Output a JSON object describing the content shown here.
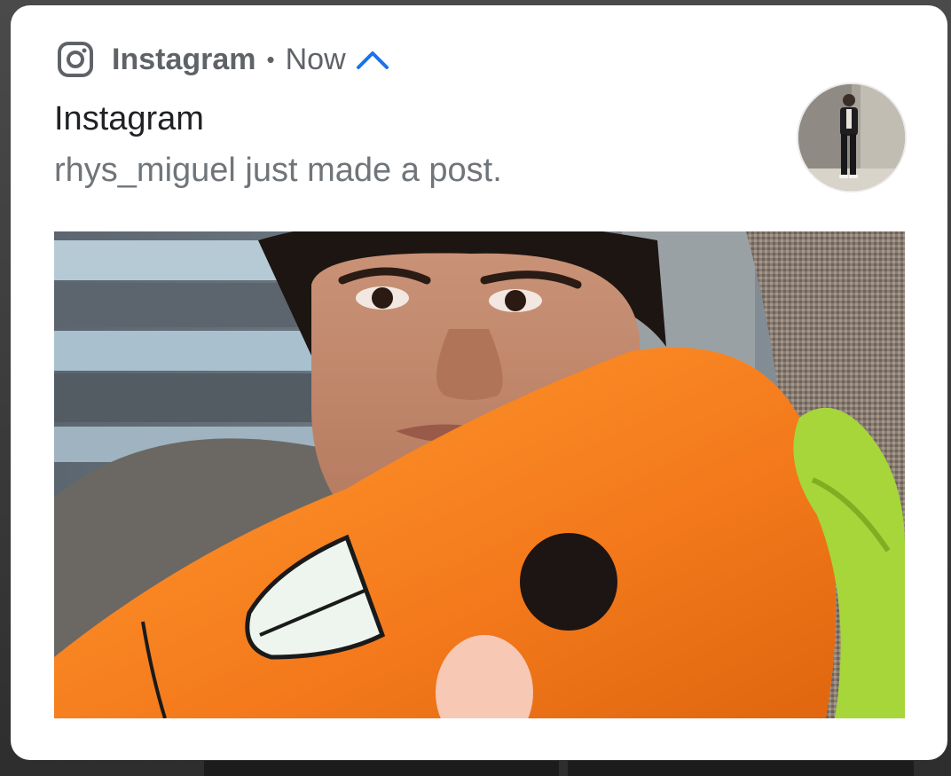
{
  "notification": {
    "app_name": "Instagram",
    "separator": "•",
    "time": "Now",
    "title": "Instagram",
    "body": "rhys_miguel just made a post."
  },
  "icons": {
    "app": "instagram-icon",
    "expand": "chevron-up-icon"
  },
  "colors": {
    "accent": "#1a73e8",
    "card": "#ffffff",
    "title": "#202124",
    "secondary": "#70757a"
  }
}
